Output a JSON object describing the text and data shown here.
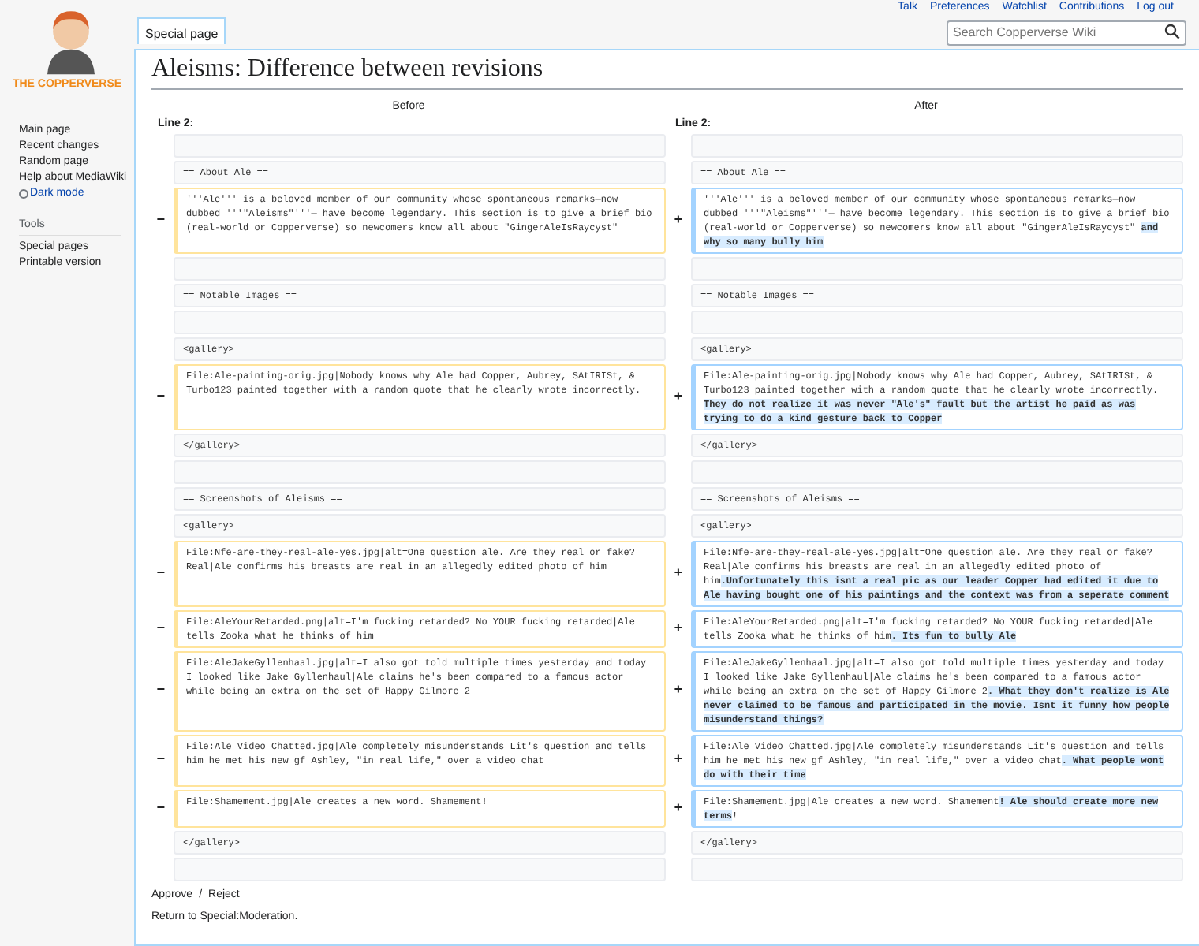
{
  "personal_links": [
    "Talk",
    "Preferences",
    "Watchlist",
    "Contributions",
    "Log out"
  ],
  "sidebar": {
    "logo_text": "THE COPPERVERSE",
    "nav": [
      {
        "label": "Main page",
        "kind": "link"
      },
      {
        "label": "Recent changes",
        "kind": "link"
      },
      {
        "label": "Random page",
        "kind": "link"
      },
      {
        "label": "Help about MediaWiki",
        "kind": "link"
      },
      {
        "label": "Dark mode",
        "kind": "toggle"
      }
    ],
    "tools_heading": "Tools",
    "tools": [
      "Special pages",
      "Printable version"
    ]
  },
  "tab": {
    "label": "Special page",
    "selected": true
  },
  "search": {
    "placeholder": "Search Copperverse Wiki"
  },
  "title": "Aleisms: Difference between revisions",
  "diff": {
    "left_header": "Before",
    "right_header": "After",
    "left_line": "Line 2:",
    "right_line": "Line 2:",
    "rows": [
      {
        "kind": "blank"
      },
      {
        "kind": "context",
        "left": "== About Ale ==",
        "right": "== About Ale =="
      },
      {
        "kind": "change",
        "left_marker": "−",
        "left": "'''Ale''' is a beloved member of our community whose spontaneous remarks—now dubbed '''\"Aleisms\"'''— have become legendary. This section is to give a brief bio (real-world or Copperverse) so newcomers know all about \"GingerAleIsRaycyst\"",
        "right_marker": "+",
        "right": "'''Ale''' is a beloved member of our community whose spontaneous remarks—now dubbed '''\"Aleisms\"'''— have become legendary. This section is to give a brief bio (real-world or Copperverse) so newcomers know all about \"GingerAleIsRaycyst\" **and why so many bully him**"
      },
      {
        "kind": "blank"
      },
      {
        "kind": "context",
        "left": "== Notable Images ==",
        "right": "== Notable Images =="
      },
      {
        "kind": "blank"
      },
      {
        "kind": "context",
        "left": "<gallery>",
        "right": "<gallery>"
      },
      {
        "kind": "change",
        "left_marker": "−",
        "left": "File:Ale-painting-orig.jpg|Nobody knows why Ale had Copper, Aubrey, SAtIRISt, & Turbo123 painted together with a random quote that he clearly wrote incorrectly.",
        "right_marker": "+",
        "right": "File:Ale-painting-orig.jpg|Nobody knows why Ale had Copper, Aubrey, SAtIRISt, & Turbo123 painted together with a random quote that he clearly wrote incorrectly. **They do not realize it was never \"Ale's\" fault but the artist he paid as was trying to do a kind gesture back to Copper**"
      },
      {
        "kind": "context",
        "left": "</gallery>",
        "right": "</gallery>"
      },
      {
        "kind": "blank"
      },
      {
        "kind": "context",
        "left": "== Screenshots of Aleisms ==",
        "right": "== Screenshots of Aleisms =="
      },
      {
        "kind": "context",
        "left": "<gallery>",
        "right": "<gallery>"
      },
      {
        "kind": "change",
        "left_marker": "−",
        "left": "File:Nfe-are-they-real-ale-yes.jpg|alt=One question ale. Are they real or fake? Real|Ale confirms his breasts are real in an allegedly edited photo of him",
        "right_marker": "+",
        "right": "File:Nfe-are-they-real-ale-yes.jpg|alt=One question ale. Are they real or fake? Real|Ale confirms his breasts are real in an allegedly edited photo of him**.Unfortunately this isnt a real pic as our leader Copper had edited it due to Ale having bought one of his paintings and the context was from a seperate comment**"
      },
      {
        "kind": "change",
        "left_marker": "−",
        "left": "File:AleYourRetarded.png|alt=I'm fucking retarded? No YOUR fucking retarded|Ale tells Zooka what he thinks of him",
        "right_marker": "+",
        "right": "File:AleYourRetarded.png|alt=I'm fucking retarded? No YOUR fucking retarded|Ale tells Zooka what he thinks of him**. Its fun to bully Ale**"
      },
      {
        "kind": "change",
        "left_marker": "−",
        "left": "File:AleJakeGyllenhaal.jpg|alt=I also got told multiple times yesterday and today I looked like Jake Gyllenhaul|Ale claims he's been compared to a famous actor while being an extra on the set of Happy Gilmore 2",
        "right_marker": "+",
        "right": "File:AleJakeGyllenhaal.jpg|alt=I also got told multiple times yesterday and today I looked like Jake Gyllenhaul|Ale claims he's been compared to a famous actor while being an extra on the set of Happy Gilmore 2**. What they don't realize is Ale never claimed to be famous and participated in the movie. Isnt it funny how people misunderstand things?**"
      },
      {
        "kind": "change",
        "left_marker": "−",
        "left": "File:Ale Video Chatted.jpg|Ale completely misunderstands Lit's question and tells him he met his new gf Ashley, \"in real life,\" over a video chat",
        "right_marker": "+",
        "right": "File:Ale Video Chatted.jpg|Ale completely misunderstands Lit's question and tells him he met his new gf Ashley, \"in real life,\" over a video chat**. What people wont do with their time**"
      },
      {
        "kind": "change",
        "left_marker": "−",
        "left": "File:Shamement.jpg|Ale creates a new word. Shamement!",
        "right_marker": "+",
        "right": "File:Shamement.jpg|Ale creates a new word. Shamement**! Ale should create more new terms**!"
      },
      {
        "kind": "context",
        "left": "</gallery>",
        "right": "</gallery>"
      },
      {
        "kind": "blank"
      }
    ]
  },
  "footer": {
    "approve": "Approve",
    "separator": "/",
    "reject": "Reject",
    "return_prefix": "Return to ",
    "return_link": "Special:Moderation",
    "return_suffix": "."
  }
}
